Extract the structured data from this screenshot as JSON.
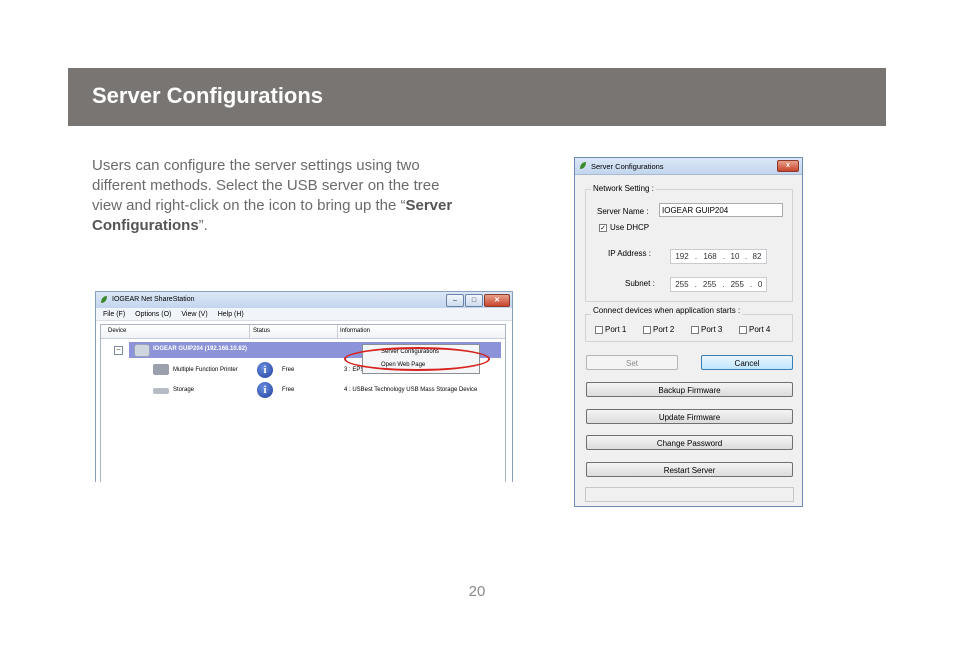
{
  "header": {
    "title": "Server Configurations"
  },
  "intro": {
    "text_before": "Users can configure the server settings using two different methods. Select the USB server on the tree view and right-click on the icon to bring up the “",
    "bold": "Server Configurations",
    "text_after": "”."
  },
  "page_number": "20",
  "netshare_window": {
    "title": "IOGEAR Net ShareStation",
    "menu": [
      "File (F)",
      "Options (O)",
      "View (V)",
      "Help (H)"
    ],
    "columns": [
      "Device",
      "Status",
      "Information"
    ],
    "server_label": "IOGEAR GUIP204  (192.168.10.82)",
    "devices": [
      {
        "name": "Multiple Function Printer",
        "status": "Free",
        "info": "3 : EPSO"
      },
      {
        "name": "Storage",
        "status": "Free",
        "info": "4 : USBest Technology USB Mass Storage Device"
      }
    ],
    "context_menu": [
      "Server Configurations",
      "Open Web Page"
    ],
    "highlight_color": "#d8231e"
  },
  "dialog": {
    "title": "Server Configurations",
    "close_label": "x",
    "network_setting_label": "Network Setting :",
    "server_name_label": "Server Name :",
    "server_name_value": "IOGEAR GUIP204",
    "use_dhcp_label": "Use DHCP",
    "use_dhcp_checked": true,
    "ip_label": "IP Address :",
    "ip_parts": [
      "192",
      ".",
      "168",
      ".",
      "10",
      ".",
      "82"
    ],
    "subnet_label": "Subnet :",
    "subnet_parts": [
      "255",
      ".",
      "255",
      ".",
      "255",
      ".",
      "0"
    ],
    "connect_label": "Connect devices when application starts :",
    "ports": [
      "Port 1",
      "Port 2",
      "Port 3",
      "Port 4"
    ],
    "set_label": "Set",
    "cancel_label": "Cancel",
    "backup_label": "Backup Firmware",
    "update_label": "Update Firmware",
    "change_password_label": "Change Password",
    "restart_label": "Restart Server"
  }
}
